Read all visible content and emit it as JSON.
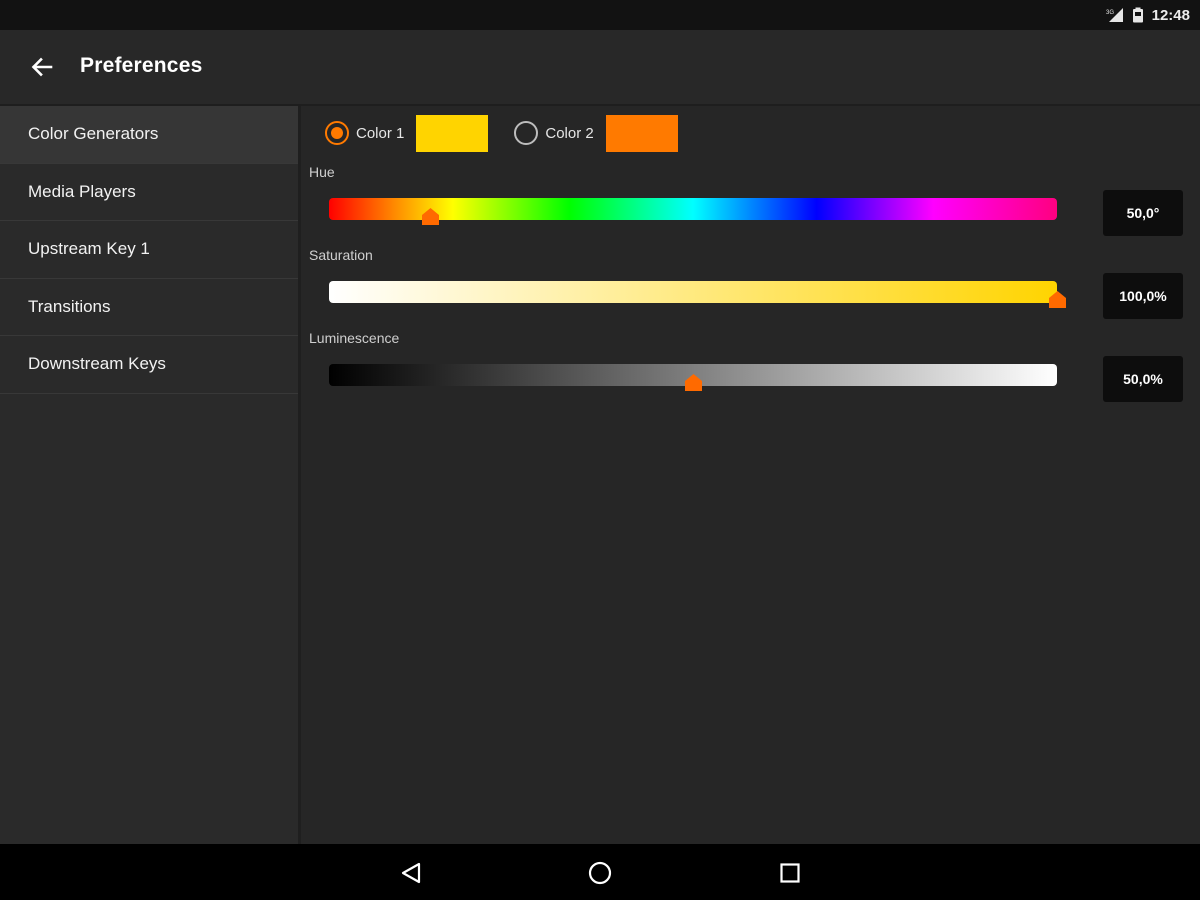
{
  "status_bar": {
    "time": "12:48",
    "icons": [
      "signal-icon",
      "battery-icon"
    ]
  },
  "app_bar": {
    "title": "Preferences",
    "back_icon": "arrow-left-icon"
  },
  "sidebar": {
    "items": [
      {
        "label": "Color Generators",
        "active": true
      },
      {
        "label": "Media Players",
        "active": false
      },
      {
        "label": "Upstream Key 1",
        "active": false
      },
      {
        "label": "Transitions",
        "active": false
      },
      {
        "label": "Downstream Keys",
        "active": false
      }
    ]
  },
  "color_selector": {
    "options": [
      {
        "label": "Color 1",
        "selected": true,
        "swatch": "#ffd400"
      },
      {
        "label": "Color 2",
        "selected": false,
        "swatch": "#ff7a00"
      }
    ]
  },
  "sliders": {
    "hue": {
      "label": "Hue",
      "value": "50,0°",
      "position_fraction": 0.139
    },
    "saturation": {
      "label": "Saturation",
      "value": "100,0%",
      "position_fraction": 1.0
    },
    "luminescence": {
      "label": "Luminescence",
      "value": "50,0%",
      "position_fraction": 0.5
    }
  },
  "colors": {
    "accent": "#ff7a00",
    "background": "#262626"
  },
  "nav_bar": {
    "buttons": [
      "back-triangle-icon",
      "home-circle-icon",
      "recents-square-icon"
    ]
  }
}
